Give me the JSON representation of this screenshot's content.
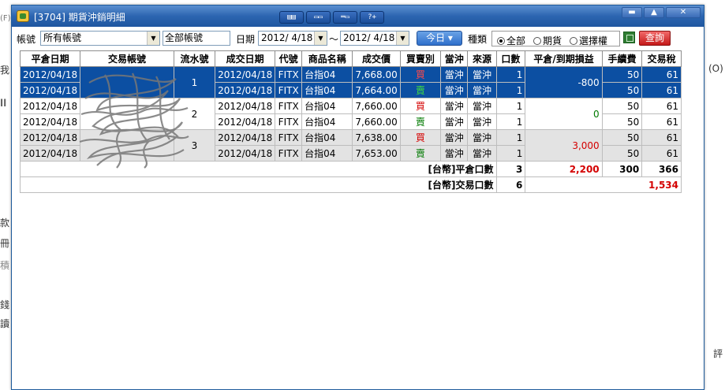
{
  "background": {
    "left_fragments": [
      "(F)",
      "我",
      "ll",
      "款",
      "冊",
      "積",
      "錢",
      "讀"
    ],
    "right_fragments": [
      "(O)",
      "評"
    ]
  },
  "window": {
    "title": "[3704] 期貨沖銷明細",
    "toolbar_buttons": [
      {
        "name": "tile-horizontal-icon",
        "glyph": "▤▤"
      },
      {
        "name": "window-restore-icon",
        "glyph": "▭▭"
      },
      {
        "name": "window-cascade-icon",
        "glyph": "═▭"
      },
      {
        "name": "help-icon",
        "glyph": "?+"
      }
    ],
    "controls": {
      "minimize": "▬",
      "restore": "▲",
      "close": "✕"
    }
  },
  "filters": {
    "account_label": "帳號",
    "account_value": "所有帳號",
    "account_name": "全部帳號",
    "date_label": "日期",
    "date_from": "2012/ 4/18",
    "date_sep": "～",
    "date_to": "2012/ 4/18",
    "today_button": "今日 ▾",
    "type_label": "種類",
    "type_options": [
      {
        "label": "全部",
        "selected": true
      },
      {
        "label": "期貨",
        "selected": false
      },
      {
        "label": "選擇權",
        "selected": false
      }
    ],
    "excel_icon": "excel-export-icon",
    "query_button": "查詢"
  },
  "table": {
    "columns": [
      "平倉日期",
      "交易帳號",
      "流水號",
      "成交日期",
      "代號",
      "商品名稱",
      "成交價",
      "買賣別",
      "當沖",
      "來源",
      "口數",
      "平倉/到期損益",
      "手續費",
      "交易稅"
    ],
    "groups": [
      {
        "serial": "1",
        "pnl": "-800",
        "pnl_sign": "neg",
        "style": "sel",
        "rows": [
          {
            "close_date": "2012/04/18",
            "account": "",
            "trade_date": "2012/04/18",
            "code": "FITX",
            "product": "台指04",
            "price": "7,668.00",
            "side": "買",
            "side_type": "buy",
            "daytrade": "當沖",
            "source": "當沖",
            "qty": "1",
            "fee": "50",
            "tax": "61"
          },
          {
            "close_date": "2012/04/18",
            "account": "",
            "trade_date": "2012/04/18",
            "code": "FITX",
            "product": "台指04",
            "price": "7,664.00",
            "side": "賣",
            "side_type": "sell",
            "daytrade": "當沖",
            "source": "當沖",
            "qty": "1",
            "fee": "50",
            "tax": "61"
          }
        ]
      },
      {
        "serial": "2",
        "pnl": "0",
        "pnl_sign": "zero",
        "style": "white",
        "rows": [
          {
            "close_date": "2012/04/18",
            "account": "",
            "trade_date": "2012/04/18",
            "code": "FITX",
            "product": "台指04",
            "price": "7,660.00",
            "side": "買",
            "side_type": "buy",
            "daytrade": "當沖",
            "source": "當沖",
            "qty": "1",
            "fee": "50",
            "tax": "61"
          },
          {
            "close_date": "2012/04/18",
            "account": "",
            "trade_date": "2012/04/18",
            "code": "FITX",
            "product": "台指04",
            "price": "7,660.00",
            "side": "賣",
            "side_type": "sell",
            "daytrade": "當沖",
            "source": "當沖",
            "qty": "1",
            "fee": "50",
            "tax": "61"
          }
        ]
      },
      {
        "serial": "3",
        "pnl": "3,000",
        "pnl_sign": "pos",
        "style": "gray",
        "rows": [
          {
            "close_date": "2012/04/18",
            "account": "",
            "trade_date": "2012/04/18",
            "code": "FITX",
            "product": "台指04",
            "price": "7,638.00",
            "side": "買",
            "side_type": "buy",
            "daytrade": "當沖",
            "source": "當沖",
            "qty": "1",
            "fee": "50",
            "tax": "61"
          },
          {
            "close_date": "2012/04/18",
            "account": "",
            "trade_date": "2012/04/18",
            "code": "FITX",
            "product": "台指04",
            "price": "7,653.00",
            "side": "賣",
            "side_type": "sell",
            "daytrade": "當沖",
            "source": "當沖",
            "qty": "1",
            "fee": "50",
            "tax": "61"
          }
        ]
      }
    ],
    "summary": {
      "close_label": "[台幣]平倉口數",
      "close_qty": "3",
      "close_pnl": "2,200",
      "close_fee": "300",
      "close_tax": "366",
      "trade_label": "[台幣]交易口數",
      "trade_qty": "6",
      "trade_total": "1,534"
    }
  },
  "colors": {
    "title_bar": "#2c65b0",
    "selected_row": "#0c4fa2",
    "buy": "#d40000",
    "sell": "#007a00",
    "query_button": "#c41919"
  }
}
